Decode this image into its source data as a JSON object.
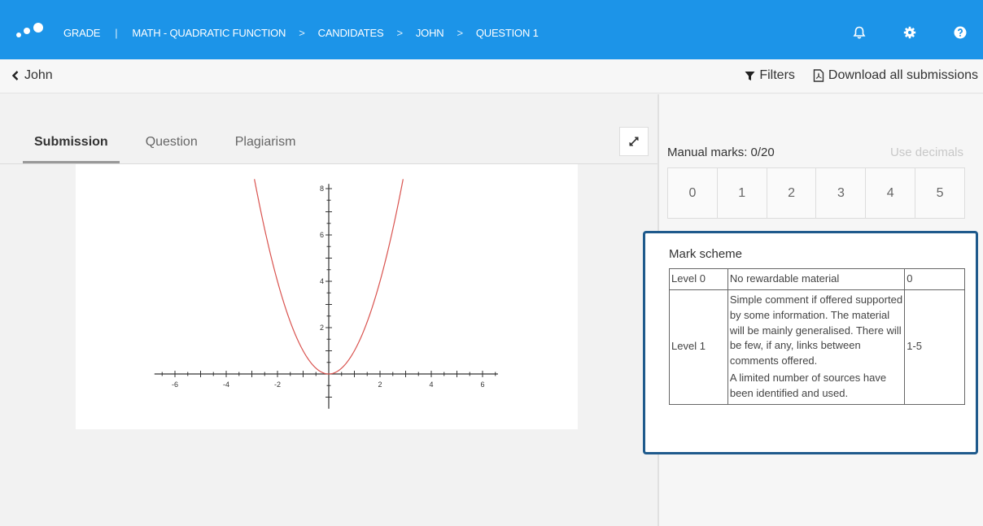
{
  "header": {
    "breadcrumbs": [
      "GRADE",
      "MATH - QUADRATIC FUNCTION",
      "CANDIDATES",
      "JOHN",
      "QUESTION 1"
    ],
    "icons": [
      "bell-icon",
      "gear-icon",
      "help-icon"
    ],
    "color": "#1c94e8"
  },
  "subbar": {
    "back_label": "John",
    "filters_label": "Filters",
    "download_label": "Download all submissions"
  },
  "tabs": [
    {
      "label": "Submission",
      "active": true
    },
    {
      "label": "Question",
      "active": false
    },
    {
      "label": "Plagiarism",
      "active": false
    }
  ],
  "graph": {
    "type": "line",
    "function": "y = x^2",
    "x_ticks": [
      "-6",
      "-4",
      "-2",
      "2",
      "4",
      "6"
    ],
    "y_ticks": [
      "2",
      "4",
      "6",
      "8"
    ],
    "xlim": [
      -7,
      7
    ],
    "ylim": [
      -1,
      8
    ],
    "curve_color": "#d9534f"
  },
  "marks": {
    "label": "Manual marks: 0/20",
    "decimals_label": "Use decimals",
    "options": [
      "0",
      "1",
      "2",
      "3",
      "4",
      "5"
    ]
  },
  "mark_scheme": {
    "title": "Mark scheme",
    "border_color": "#1f5a8c",
    "rows": [
      {
        "level": "Level 0",
        "description": [
          "No rewardable material"
        ],
        "range": "0"
      },
      {
        "level": "Level 1",
        "description": [
          "Simple comment if offered supported by some information. The material will be mainly generalised. There will be few, if any, links between comments offered.",
          "A limited number of sources have been identified and used."
        ],
        "range": "1-5"
      }
    ]
  }
}
